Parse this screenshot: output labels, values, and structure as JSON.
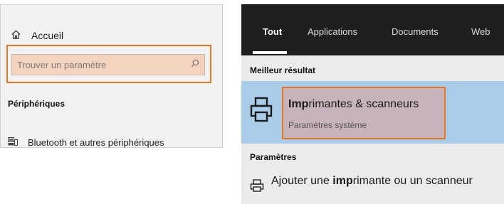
{
  "settings": {
    "home_label": "Accueil",
    "search_placeholder": "Trouver un paramètre",
    "section_title": "Périphériques",
    "items": [
      {
        "label": "Bluetooth et autres périphériques",
        "icon": "bluetooth-device-icon"
      }
    ],
    "icons": {
      "home": "home-icon",
      "search": "search-icon"
    },
    "colors": {
      "highlight_border": "#e87722",
      "search_fill": "#f4d3bf"
    }
  },
  "search_flyout": {
    "tabs": [
      {
        "label": "Tout",
        "active": true
      },
      {
        "label": "Applications",
        "active": false
      },
      {
        "label": "Documents",
        "active": false
      },
      {
        "label": "Web",
        "active": false
      }
    ],
    "best_match_label": "Meilleur résultat",
    "best_match": {
      "title_bold": "Imp",
      "title_rest": "rimantes & scanneurs",
      "subtitle": "Paramètres système",
      "icon": "printer-icon"
    },
    "settings_label": "Paramètres",
    "setting_result": {
      "text_before": "Ajouter une ",
      "text_bold": "imp",
      "text_after": "rimante ou un scanneur",
      "icon": "printer-small-icon"
    },
    "colors": {
      "tab_bar": "#1f1f1f",
      "selected_row": "#a9cde8",
      "highlight_border": "#e87722"
    }
  }
}
